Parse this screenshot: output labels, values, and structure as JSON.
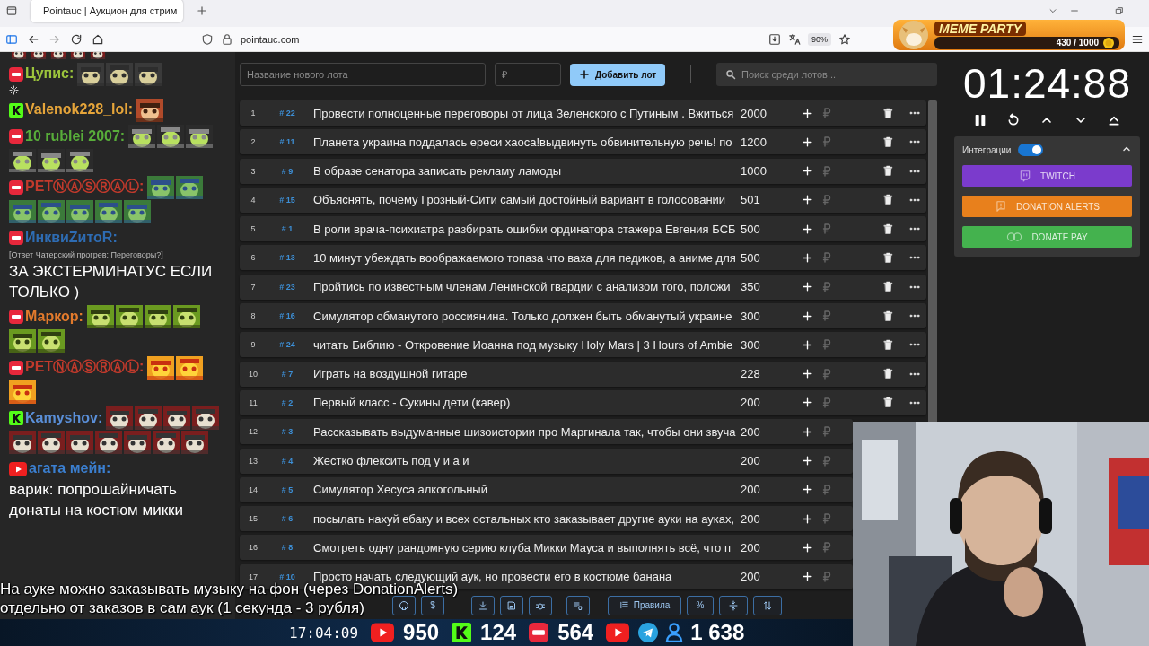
{
  "browser": {
    "tab": {
      "title": "Pointauc | Аукцион для стрим",
      "selected": true
    },
    "url": "pointauc.com",
    "zoom": "90%"
  },
  "overlay": {
    "logo": "MEME PARTY",
    "progress": "430 / 1000"
  },
  "chat": [
    {
      "kind": "strip"
    },
    {
      "kind": "live",
      "user": "Цупис:",
      "color": "#9cc43c"
    },
    {
      "kind": "kick",
      "user": "Valenok228_lol:",
      "color": "#e6a53a"
    },
    {
      "kind": "live",
      "user": "10 rublei 2007:",
      "color": "#58ad3a"
    },
    {
      "kind": "live",
      "user": "PETⓃⒶⓈⓇⒶⓁ:",
      "color": "#c23a2c"
    },
    {
      "kind": "live",
      "user": "ИнквиZитоR:",
      "color": "#2e6cb3",
      "reply": "[Ответ Чатерский прогрев: Переговоры?]",
      "text": "ЗА ЭКСТЕРМИНАТУС ЕСЛИ ТОЛЬКО )"
    },
    {
      "kind": "live",
      "user": "Маркор:",
      "color": "#e27a2c"
    },
    {
      "kind": "live",
      "user": "PETⓃⒶⓈⓇⒶⓁ:",
      "color": "#c23a2c"
    },
    {
      "kind": "kick",
      "user": "Kamyshov:",
      "color": "#5a8fd8"
    },
    {
      "kind": "youtube",
      "user": "агата мейн:",
      "color": "#3b7fd0",
      "text": "варик: попрошайничать донаты на костюм микки"
    }
  ],
  "lot_form": {
    "name_placeholder": "Название нового лота",
    "price_placeholder": "₽",
    "add_button": "Добавить лот",
    "search_placeholder": "Поиск среди лотов..."
  },
  "lots": [
    {
      "index": "1",
      "id": "# 22",
      "title": "Провести полноценные переговоры от лица Зеленского с Путиным . Вжиться",
      "amount": "2000",
      "covered": false
    },
    {
      "index": "2",
      "id": "# 11",
      "title": "Планета украина поддалась ереси хаоса!выдвинуть обвинительную речь! по",
      "amount": "1200",
      "covered": false
    },
    {
      "index": "3",
      "id": "# 9",
      "title": "В образе сенатора записать рекламу ламоды",
      "amount": "1000",
      "covered": false
    },
    {
      "index": "4",
      "id": "# 15",
      "title": "Объяснять, почему Грозный-Сити самый достойный вариант в голосовании",
      "amount": "501",
      "covered": false
    },
    {
      "index": "5",
      "id": "# 1",
      "title": "В роли врача-психиатра разбирать ошибки ординатора стажера Евгения БСБ",
      "amount": "500",
      "covered": false
    },
    {
      "index": "6",
      "id": "# 13",
      "title": "10 минут убеждать воображаемого топаза что ваха для педиков, а аниме для",
      "amount": "500",
      "covered": false
    },
    {
      "index": "7",
      "id": "# 23",
      "title": "Пройтись по известным членам Ленинской гвардии с анализом того, положи",
      "amount": "350",
      "covered": false
    },
    {
      "index": "8",
      "id": "# 16",
      "title": "Симулятор обманутого россиянина. Только должен быть обманутый украине",
      "amount": "300",
      "covered": false
    },
    {
      "index": "9",
      "id": "# 24",
      "title": "читать Библию - Откровение Иоанна под музыку Holy Mars | 3 Hours of Ambie",
      "amount": "300",
      "covered": false
    },
    {
      "index": "10",
      "id": "# 7",
      "title": "Играть на воздушной гитаре",
      "amount": "228",
      "covered": false
    },
    {
      "index": "11",
      "id": "# 2",
      "title": "Первый класс - Сукины дети (кавер)",
      "amount": "200",
      "covered": false
    },
    {
      "index": "12",
      "id": "# 3",
      "title": "Рассказывать выдуманные шизоистории про Маргинала так, чтобы они звуча",
      "amount": "200",
      "covered": true
    },
    {
      "index": "13",
      "id": "# 4",
      "title": "Жестко флексить под у и а и",
      "amount": "200",
      "covered": true
    },
    {
      "index": "14",
      "id": "# 5",
      "title": "Симулятор Хесуса алкогольный",
      "amount": "200",
      "covered": true
    },
    {
      "index": "15",
      "id": "# 6",
      "title": "посылать нахуй ебаку и всех остальных кто заказывает другие ауки на ауках,",
      "amount": "200",
      "covered": true
    },
    {
      "index": "16",
      "id": "# 8",
      "title": "Смотреть одну рандомную серию клуба Микки Мауса и выполнять всё, что п",
      "amount": "200",
      "covered": true
    },
    {
      "index": "17",
      "id": "# 10",
      "title": "Просто начать следующий аук, но провести его в костюме банана",
      "amount": "200",
      "covered": true
    }
  ],
  "toolbar": {
    "currency": "$",
    "rules": "Правила",
    "percent": "%"
  },
  "timer": {
    "time": "01:24:88",
    "paused": false
  },
  "integrations": {
    "label": "Интеграции",
    "on": true,
    "expanded": true,
    "buttons": [
      {
        "kind": "twitch",
        "label": "TWITCH",
        "color": "#7b3bcc"
      },
      {
        "kind": "donationalerts",
        "label": "DONATION ALERTS",
        "color": "#e8801c"
      },
      {
        "kind": "donatepay",
        "label": "DONATE PAY",
        "color": "#44b24e"
      }
    ]
  },
  "caption": [
    "На ауке можно заказывать музыку на фон (через DonationAlerts)",
    "отдельно от заказов в сам аук (1 секунда - 3 рубля)"
  ],
  "stream_bar": {
    "time": "17:04:09",
    "counters": [
      {
        "kind": "youtube",
        "value": "950"
      },
      {
        "kind": "kick",
        "value": "124"
      },
      {
        "kind": "live",
        "value": "564"
      },
      {
        "kind": "youtube"
      },
      {
        "kind": "telegram"
      },
      {
        "kind": "viewers",
        "value": "1 638"
      }
    ]
  }
}
